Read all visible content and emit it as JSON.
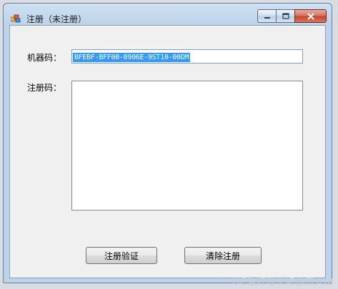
{
  "window": {
    "title": "注册（未注册）",
    "icons": {
      "app": "app-icon",
      "minimize": "minimize-icon",
      "maximize": "maximize-icon",
      "close": "close-icon"
    }
  },
  "form": {
    "machine_code_label": "机器码：",
    "machine_code_value": "BFEBF-BFF00-0906E-9ST10-00DM",
    "registration_code_label": "注册码：",
    "registration_code_value": ""
  },
  "buttons": {
    "verify_label": "注册验证",
    "clear_label": "清除注册"
  },
  "watermark": "UC爱好者论坛@黄大山",
  "colors": {
    "selection": "#3399ff",
    "close_button": "#c4432b",
    "title_bar": "#bcd3ea"
  }
}
